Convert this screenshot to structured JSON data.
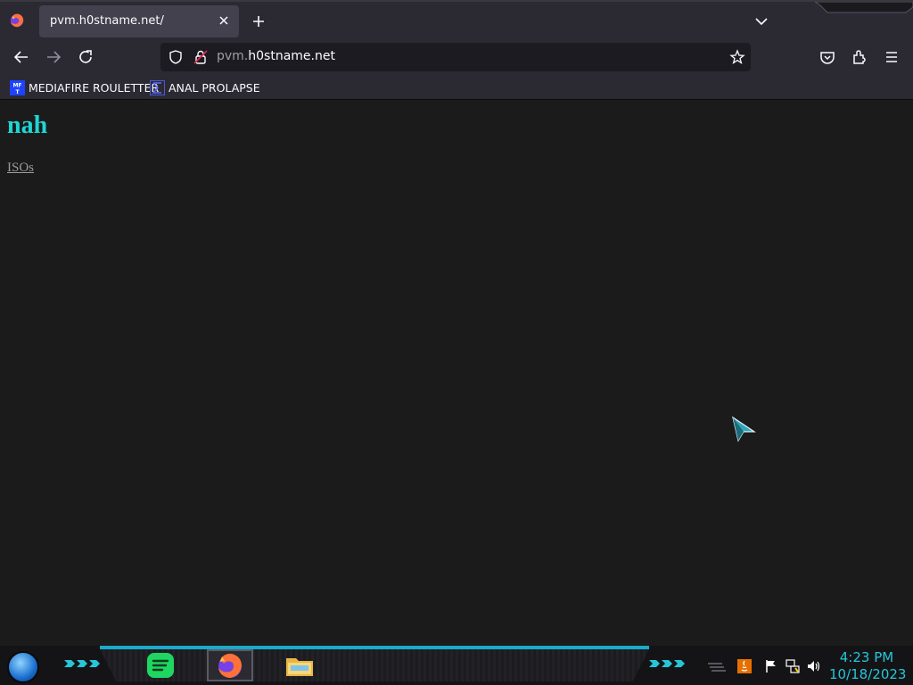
{
  "browser": {
    "tab": {
      "title": "pvm.h0stname.net/"
    },
    "url": {
      "domain_prefix": "pvm.",
      "domain_main": "h0stname.net"
    },
    "icons": {
      "back": "arrow-left-icon",
      "forward": "arrow-right-icon",
      "reload": "reload-icon",
      "shield": "shield-icon",
      "lock": "lock-icon",
      "star": "star-icon",
      "pocket": "pocket-icon",
      "extensions": "extensions-icon",
      "menu": "hamburger-menu-icon"
    },
    "bookmarks": [
      {
        "label": "MEDIAFIRE ROULETTER",
        "icon_text": "MFT"
      },
      {
        "label": "ANAL PROLAPSE"
      }
    ]
  },
  "page": {
    "heading": "nah",
    "link": "ISOs",
    "colors": {
      "heading": "#1fd5d5",
      "link": "#9a9a9a",
      "background": "#1b1b1b"
    }
  },
  "taskbar": {
    "apps": [
      "spotify-icon",
      "firefox-icon",
      "file-explorer-icon"
    ],
    "tray": [
      "java-icon",
      "flag-icon",
      "network-icon",
      "volume-icon"
    ],
    "clock": {
      "time": "4:23 PM",
      "date": "10/18/2023"
    },
    "accent": "#26c6d9"
  }
}
